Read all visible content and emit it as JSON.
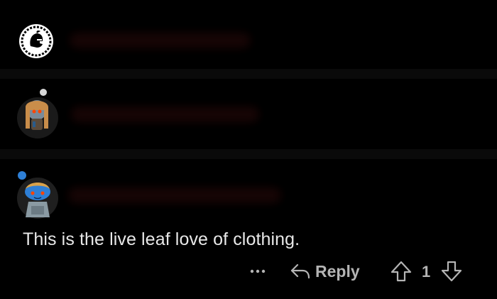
{
  "thread": {
    "comments": [
      {
        "author_hidden": true,
        "avatar": "spartan-helmet-icon"
      },
      {
        "author_hidden": true,
        "avatar": "snoo-blonde-avatar"
      },
      {
        "author_hidden": true,
        "avatar": "snoo-blue-avatar",
        "body": "This is the live leaf love of clothing."
      }
    ]
  },
  "actions": {
    "more_icon": "ellipsis-icon",
    "reply_label": "Reply",
    "upvote_icon": "upvote-arrow-icon",
    "vote_count": "1",
    "downvote_icon": "downvote-arrow-icon"
  },
  "colors": {
    "background": "#000000",
    "text": "#e8e8e8",
    "muted": "#b4b4b4",
    "divider": "#0a0a0a"
  }
}
